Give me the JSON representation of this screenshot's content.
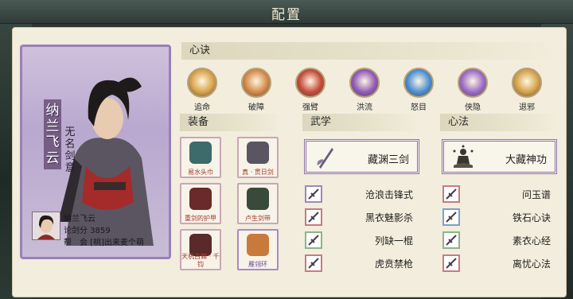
{
  "window": {
    "title": "配置"
  },
  "character": {
    "name_vertical": "纳兰飞云",
    "title_vertical": "无名剑意",
    "name": "纳兰飞云",
    "score_line": "论剑分 3859",
    "guild_line": "帮　会 [桃]出来麦个萌"
  },
  "sections": {
    "xinjue": "心诀",
    "zhuangbei": "装备",
    "wuxue": "武学",
    "xinfa": "心法"
  },
  "xinjue_skills": [
    {
      "label": "追命",
      "icon": "chase-skill-icon",
      "color": "#d8a24a"
    },
    {
      "label": "破障",
      "icon": "break-skill-icon",
      "color": "#d48a4a"
    },
    {
      "label": "强臂",
      "icon": "arm-skill-icon",
      "color": "#c44a3a"
    },
    {
      "label": "洪流",
      "icon": "flood-skill-icon",
      "color": "#8e5ab8"
    },
    {
      "label": "怒目",
      "icon": "eye-skill-icon",
      "color": "#4a8ed4"
    },
    {
      "label": "侠隐",
      "icon": "hidden-skill-icon",
      "color": "#9a6ac8"
    },
    {
      "label": "退邪",
      "icon": "ward-skill-icon",
      "color": "#d4a24a"
    }
  ],
  "equipment": [
    {
      "label": "易水头巾",
      "icon": "headband-icon",
      "rarity": "red"
    },
    {
      "label": "真 · 贯日剑",
      "icon": "sword-icon",
      "rarity": "red"
    },
    {
      "label": "重剑的护甲",
      "icon": "armor-icon",
      "rarity": "red"
    },
    {
      "label": "卢生剑带",
      "icon": "belt-icon",
      "rarity": "red"
    },
    {
      "label": "天机古籍 · 千钧",
      "icon": "book-icon",
      "rarity": "red"
    },
    {
      "label": "雁翎环",
      "icon": "ring-icon",
      "rarity": "purple"
    }
  ],
  "wuxue": {
    "main": {
      "label": "藏渊三剑",
      "icon": "sword-art-icon"
    },
    "subs": [
      {
        "label": "沧浪击锋式",
        "icon": "strike-icon",
        "tone": "purple"
      },
      {
        "label": "黑衣魅影杀",
        "icon": "shadow-icon",
        "tone": "red"
      },
      {
        "label": "列缺一棍",
        "icon": "staff-icon",
        "tone": "green"
      },
      {
        "label": "虎贲禁枪",
        "icon": "spear-icon",
        "tone": "red"
      }
    ]
  },
  "xinfa": {
    "main": {
      "label": "大藏神功",
      "icon": "meditation-icon"
    },
    "subs": [
      {
        "label": "问玉谱",
        "icon": "jade-icon",
        "tone": "red"
      },
      {
        "label": "铁石心诀",
        "icon": "iron-icon",
        "tone": "blue"
      },
      {
        "label": "素衣心经",
        "icon": "scripture-icon",
        "tone": "green"
      },
      {
        "label": "离忧心法",
        "icon": "sorrow-icon",
        "tone": "red"
      }
    ]
  }
}
